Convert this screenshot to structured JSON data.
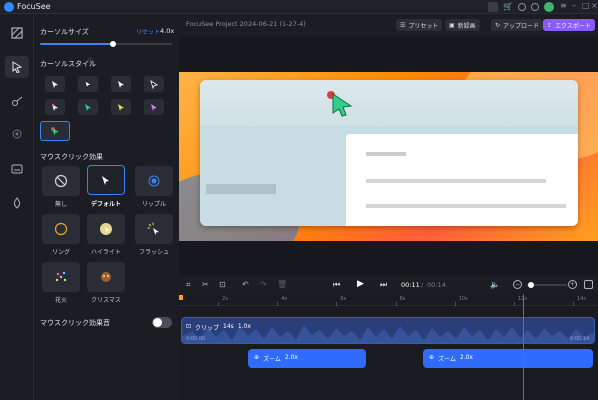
{
  "app": {
    "name": "FocuSee"
  },
  "toolbar": {
    "project_title": "FocuSee Project 2024-06-21 (1-27-4)",
    "buttons": [
      {
        "label": "プリセット"
      },
      {
        "label": "新録画"
      },
      {
        "label": "アップロード"
      },
      {
        "label": "エクスポート"
      }
    ]
  },
  "cursor_panel": {
    "cursor_size_label": "カーソルサイズ",
    "reset_label": "リセット",
    "size_value": "4.0x",
    "size_level": 0.55,
    "cursor_style_label": "カーソルスタイル",
    "click_effect_label": "マウスクリック効果",
    "effects": [
      {
        "label": "無し"
      },
      {
        "label": "デフォルト"
      },
      {
        "label": "リップル"
      },
      {
        "label": "リング"
      },
      {
        "label": "ハイライト"
      },
      {
        "label": "フラッシュ"
      },
      {
        "label": "花火"
      },
      {
        "label": "クリスマス"
      }
    ],
    "click_sound_label": "マウスクリック効果音"
  },
  "player": {
    "current_time": "00:11",
    "separator": "/",
    "total_time": "00:14"
  },
  "timeline": {
    "ticks": [
      "2s",
      "4s",
      "6s",
      "8s",
      "10s",
      "12s",
      "14s"
    ],
    "clip": {
      "label": "クリップ",
      "duration": "14s",
      "speed": "1.0x",
      "start": "0:00.00",
      "end": "0:00.14"
    },
    "zooms": [
      {
        "label": "ズーム",
        "value": "2.0x"
      },
      {
        "label": "ズーム",
        "value": "2.0x"
      }
    ]
  },
  "colors": {
    "accent": "#3b82f6",
    "export": "#8a5cf6",
    "clip_bg": "#2a3f7a",
    "zoom_bg": "#2f6bff"
  }
}
